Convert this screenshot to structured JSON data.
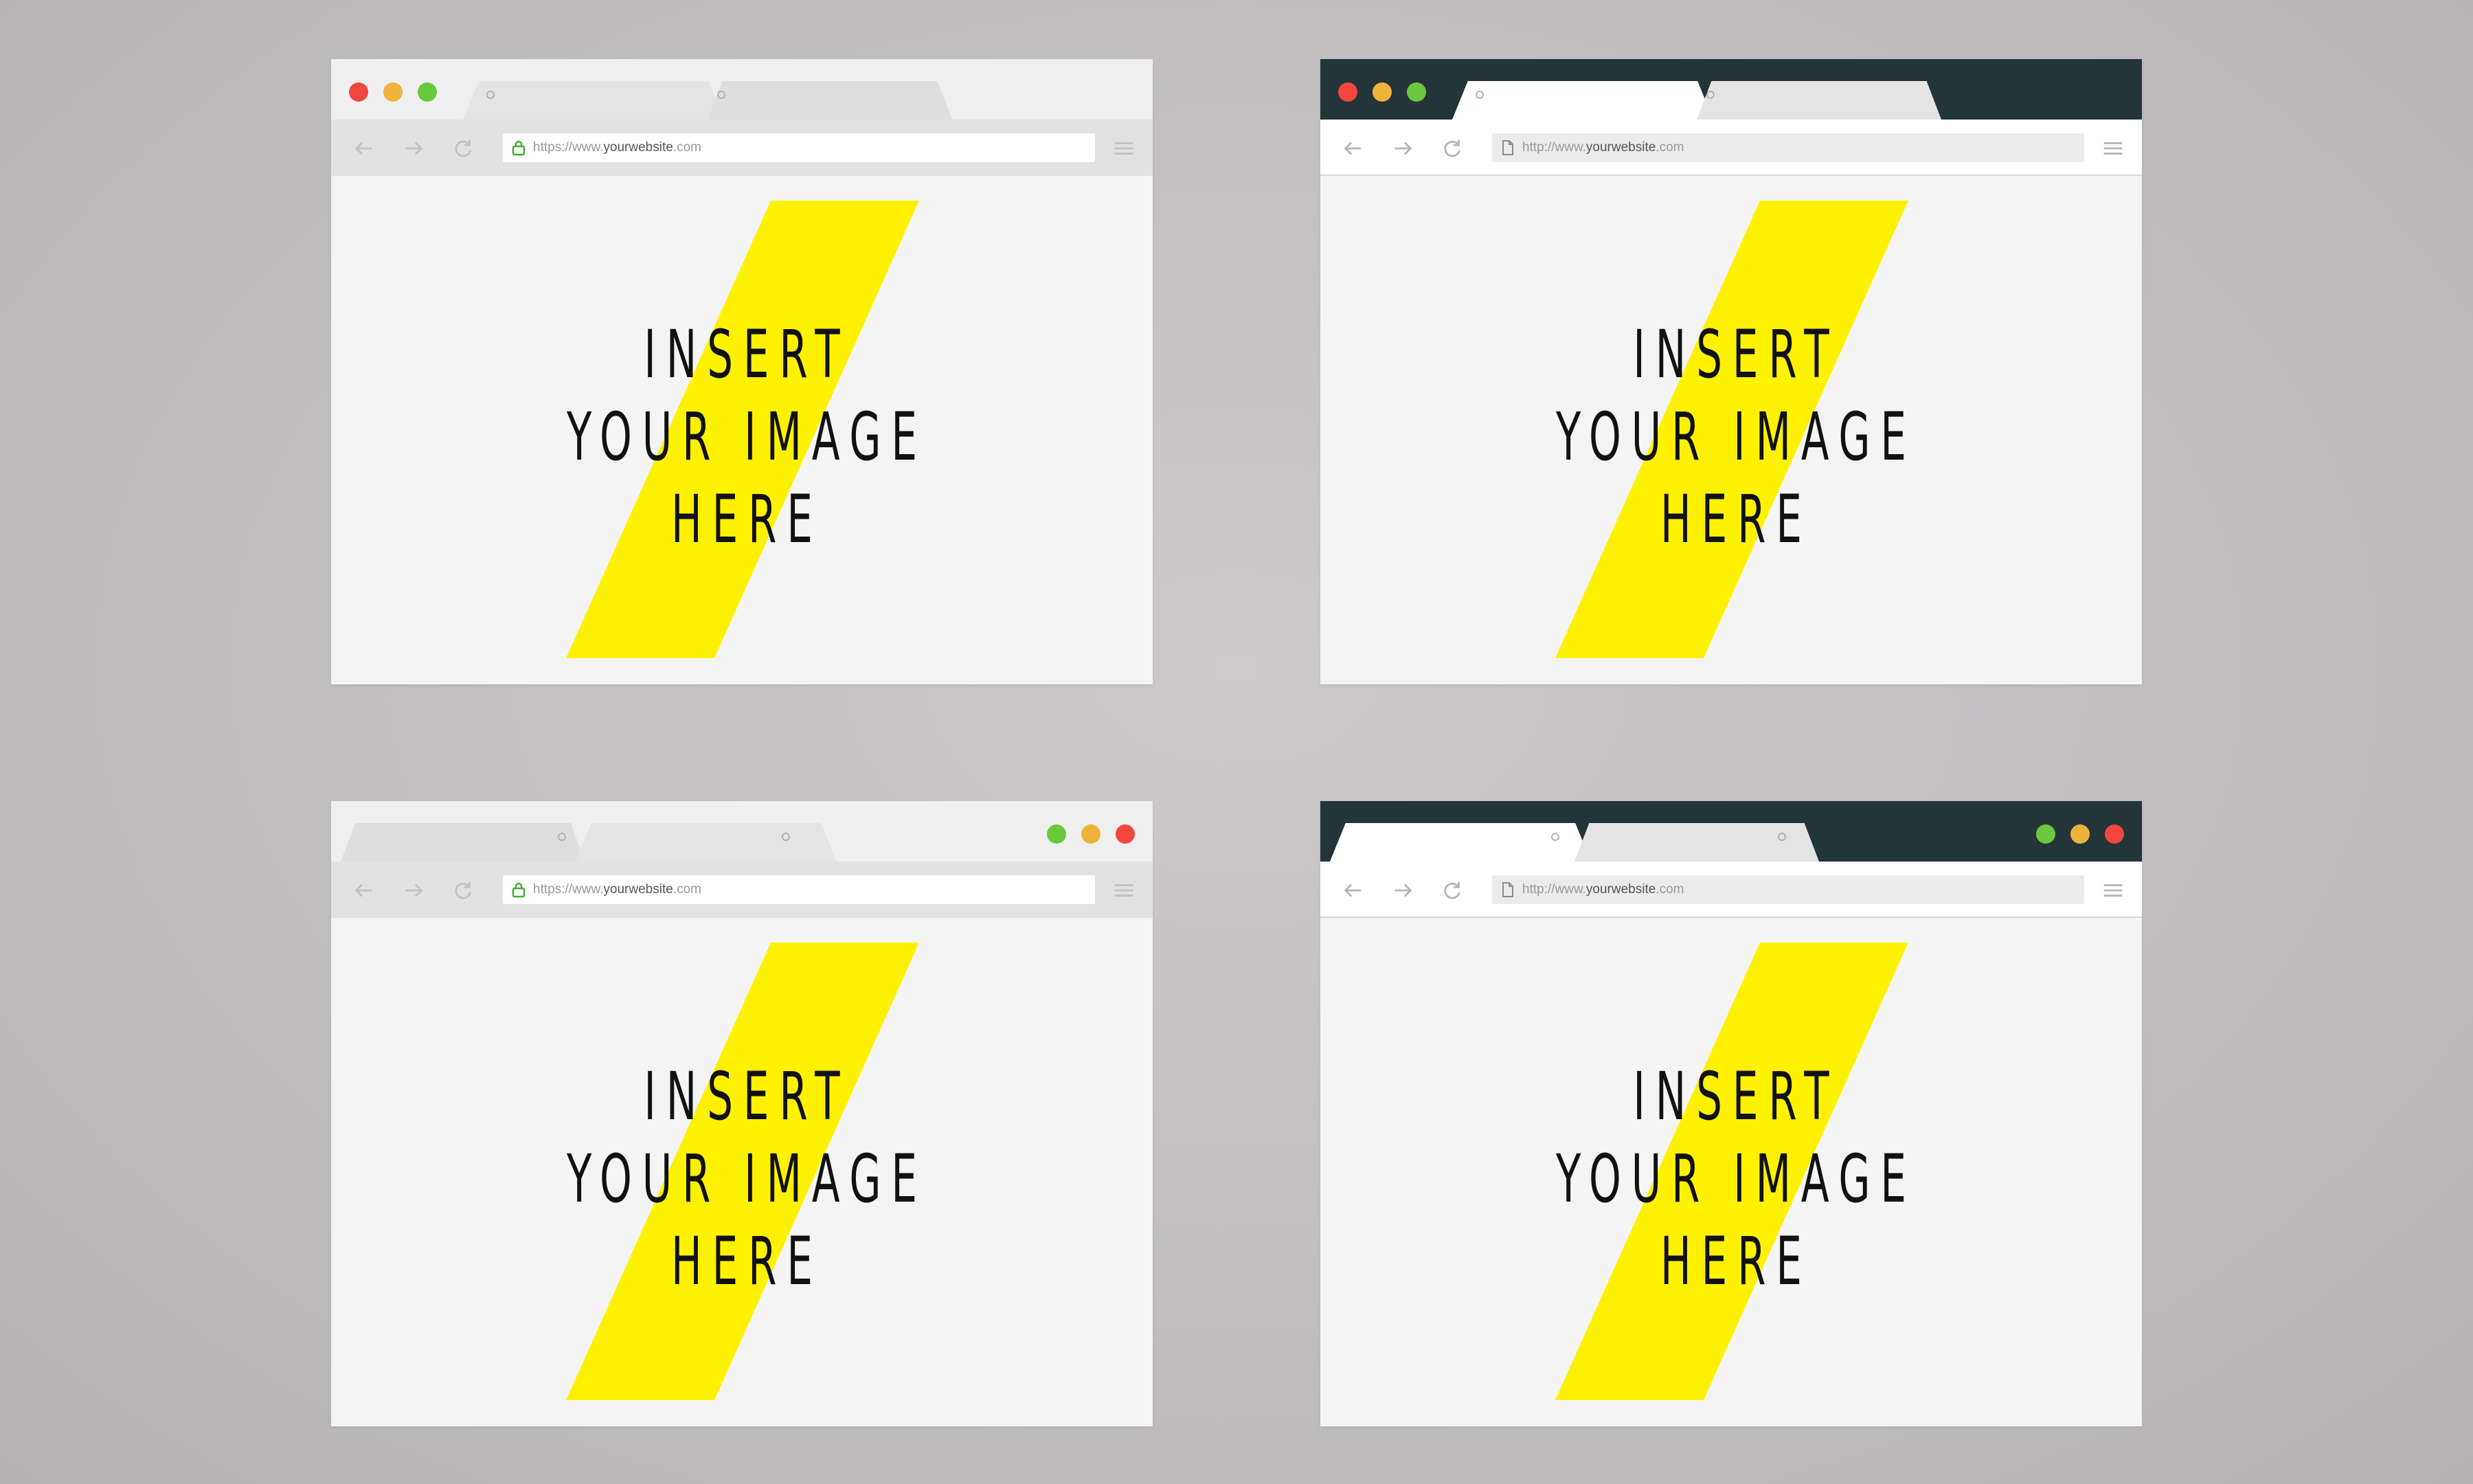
{
  "page": {
    "background_color": "#c4c2c3"
  },
  "colors": {
    "dark_titlebar": "#24353a",
    "accent_yellow": "#fff200",
    "dot_red": "#f2473f",
    "dot_yellow": "#efb33b",
    "dot_green": "#6bc83e",
    "lock_green": "#3fae2a"
  },
  "placeholder": {
    "line1": "INSERT",
    "line2": "YOUR IMAGE",
    "line3": "HERE"
  },
  "browsers": [
    {
      "id": "top-left",
      "theme": "light",
      "controls_side": "left",
      "url": {
        "prefix": "https://www.",
        "domain": "yourwebsite",
        "suffix": ".com",
        "icon": "lock-icon"
      }
    },
    {
      "id": "top-right",
      "theme": "dark",
      "controls_side": "left",
      "url": {
        "prefix": "http://www.",
        "domain": "yourwebsite",
        "suffix": ".com",
        "icon": "page-icon"
      }
    },
    {
      "id": "bottom-left",
      "theme": "light",
      "controls_side": "right",
      "url": {
        "prefix": "https://www.",
        "domain": "yourwebsite",
        "suffix": ".com",
        "icon": "lock-icon"
      }
    },
    {
      "id": "bottom-right",
      "theme": "dark",
      "controls_side": "right",
      "url": {
        "prefix": "http://www.",
        "domain": "yourwebsite",
        "suffix": ".com",
        "icon": "page-icon"
      }
    }
  ],
  "icons": {
    "back": "back-arrow-icon",
    "forward": "forward-arrow-icon",
    "reload": "reload-icon",
    "menu": "hamburger-menu-icon"
  }
}
